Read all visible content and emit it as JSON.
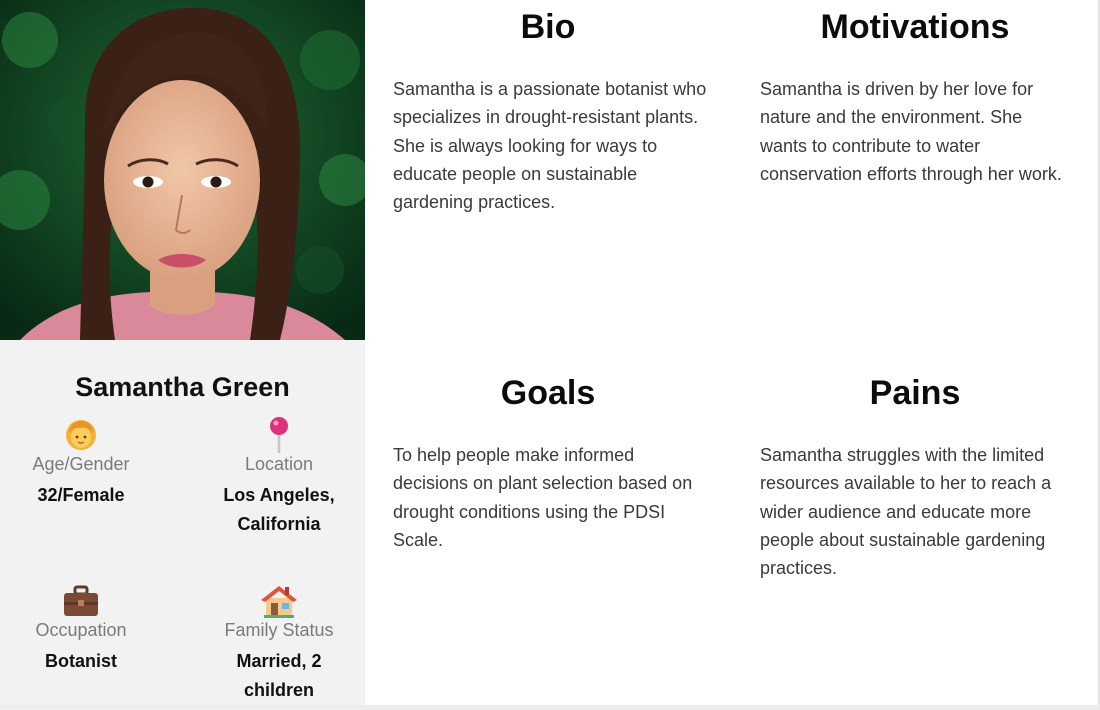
{
  "profile": {
    "name": "Samantha Green",
    "attributes": [
      {
        "icon": "woman-face-icon",
        "label": "Age/Gender",
        "value": "32/Female"
      },
      {
        "icon": "pin-icon",
        "label": "Location",
        "value": "Los Angeles, California"
      },
      {
        "icon": "briefcase-icon",
        "label": "Occupation",
        "value": "Botanist"
      },
      {
        "icon": "house-icon",
        "label": "Family Status",
        "value": "Married, 2 children"
      }
    ]
  },
  "sections": {
    "bio": {
      "title": "Bio",
      "text": "Samantha is a passionate botanist who specializes in drought-resistant plants. She is always looking for ways to educate people on sustainable gardening practices."
    },
    "motivations": {
      "title": "Motivations",
      "text": "Samantha is driven by her love for nature and the environment. She wants to contribute to water conservation efforts through her work."
    },
    "goals": {
      "title": "Goals",
      "text": "To help people make informed decisions on plant selection based on drought conditions using the PDSI Scale."
    },
    "pains": {
      "title": "Pains",
      "text": "Samantha struggles with the limited resources available to her to reach a wider audience and educate more people about sustainable gardening practices."
    }
  }
}
